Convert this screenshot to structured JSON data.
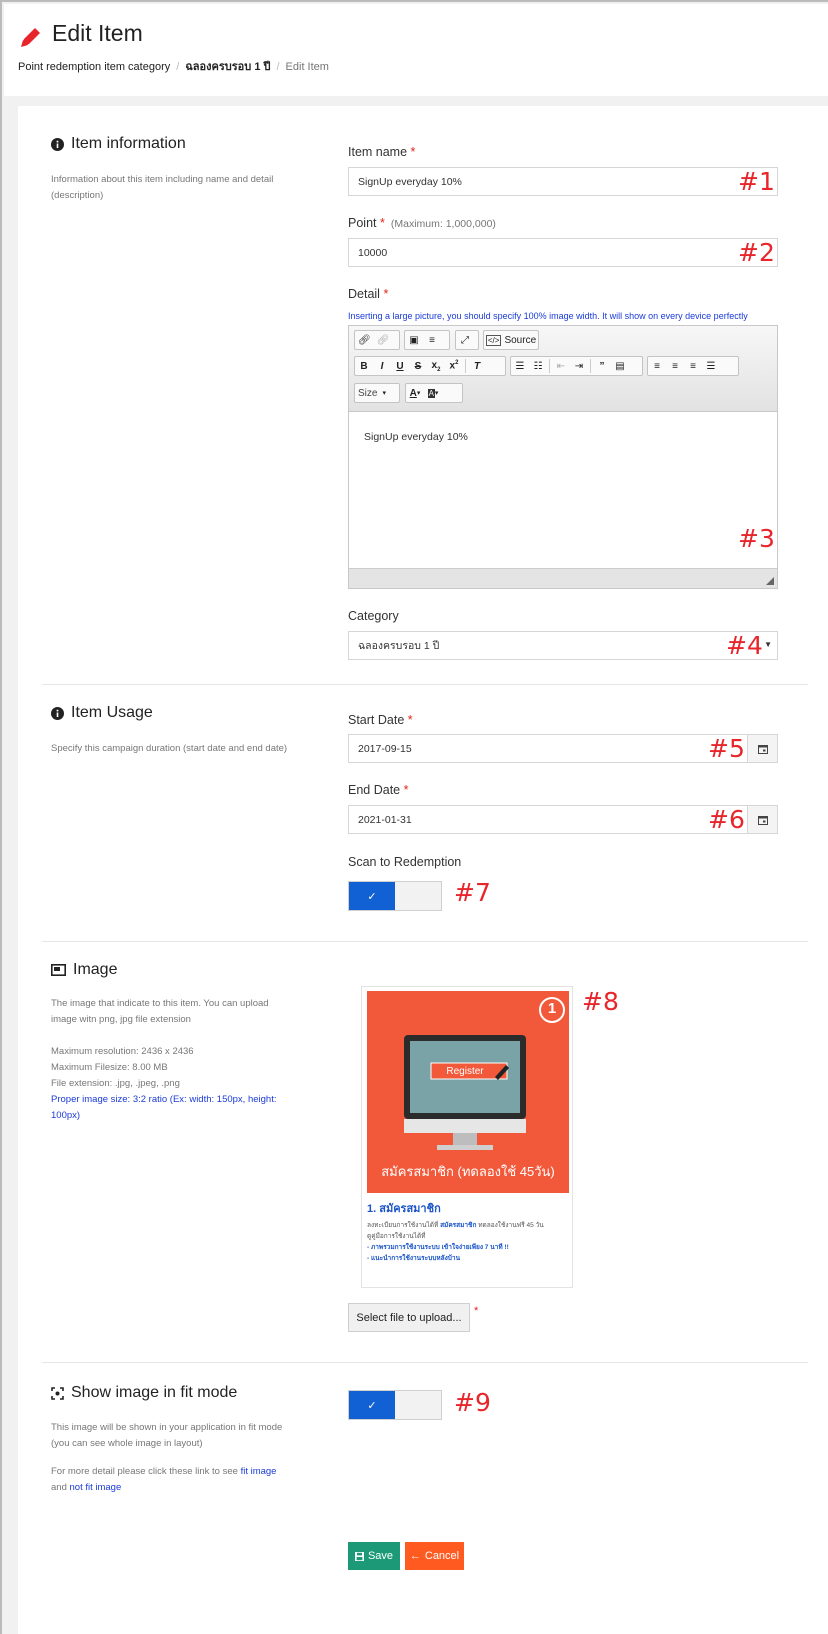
{
  "header": {
    "title": "Edit Item",
    "breadcrumb": [
      "Point redemption item category",
      "ฉลองครบรอบ 1 ปี",
      "Edit Item"
    ]
  },
  "item_information": {
    "title": "Item information",
    "description": "Information about this item including name and detail (description)"
  },
  "fields": {
    "item_name": {
      "label": "Item name",
      "value": "SignUp everyday 10%",
      "marker": "#1"
    },
    "point": {
      "label": "Point",
      "hint": "(Maximum: 1,000,000)",
      "value": "10000",
      "marker": "#2"
    },
    "detail": {
      "label": "Detail",
      "note": "Inserting a large picture, you should specify 100% image width. It will show on every device perfectly",
      "source_label": "Source",
      "size_label": "Size",
      "content": "SignUp everyday 10%",
      "marker": "#3"
    },
    "category": {
      "label": "Category",
      "value": "ฉลองครบรอบ 1 ปี",
      "marker": "#4"
    }
  },
  "item_usage": {
    "title": "Item Usage",
    "description": "Specify this campaign duration (start date and end date)",
    "start_date": {
      "label": "Start Date",
      "value": "2017-09-15",
      "marker": "#5"
    },
    "end_date": {
      "label": "End Date",
      "value": "2021-01-31",
      "marker": "#6"
    },
    "scan": {
      "label": "Scan to Redemption",
      "enabled": true,
      "marker": "#7"
    }
  },
  "image_section": {
    "title": "Image",
    "description": "The image that indicate to this item. You can upload image witn png, jpg file extension",
    "max_resolution": "Maximum resolution: 2436 x 2436",
    "max_filesize": "Maximum Filesize: 8.00 MB",
    "extensions": "File extension: .jpg, .jpeg, .png",
    "proper_size": "Proper image size: 3:2 ratio (Ex: width: 150px, height: 100px)",
    "marker": "#8",
    "preview": {
      "number": "1",
      "register_label": "Register",
      "banner_text": "สมัครสมาชิก (ทดลองใช้ 45วัน)",
      "card_title": "1. สมัครสมาชิก",
      "line1_prefix": "ลงทะเบียนการใช้งานได้ที่",
      "line1_link": "สมัครสมาชิก",
      "line1_suffix": "ทดลองใช้งานฟรี 45 วัน",
      "line2": "ดูคู่มือการใช้งานได้ที่",
      "line3": "- ภาพรวมการใช้งานระบบ เข้าใจง่ายเพียง 7 นาที !!",
      "line4": "- แนะนำการใช้งานระบบหลังบ้าน"
    },
    "upload_label": "Select file to upload..."
  },
  "fit_mode": {
    "title": "Show image in fit mode",
    "description": "This image will be shown in your application in fit mode (you can see whole image in layout)",
    "more_prefix": "For more detail please click these link to see",
    "fit_link": "fit image",
    "and_text": "and",
    "not_fit_link": "not fit image",
    "enabled": true,
    "marker": "#9"
  },
  "actions": {
    "save": "Save",
    "cancel": "Cancel"
  },
  "colors": {
    "primary": "#1160d4",
    "save": "#1c9a78",
    "cancel": "#ff5a1f",
    "required": "#e2231a",
    "link": "#1a3bd8"
  }
}
